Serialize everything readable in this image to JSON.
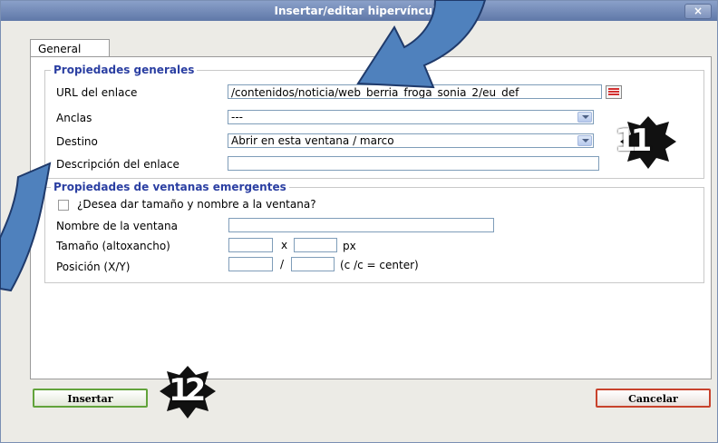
{
  "window": {
    "title": "Insertar/editar hipervínculo",
    "close_label": "×"
  },
  "tabs": [
    {
      "label": "General"
    }
  ],
  "general": {
    "legend": "Propiedades generales",
    "url": {
      "label": "URL del enlace",
      "value": "/contenidos/noticia/web_berria_froga_sonia_2/eu_def"
    },
    "anclas": {
      "label": "Anclas",
      "value": "---"
    },
    "destino": {
      "label": "Destino",
      "value": "Abrir en esta ventana / marco"
    },
    "descripcion": {
      "label": "Descripción del enlace",
      "value": ""
    }
  },
  "popup": {
    "legend": "Propiedades de ventanas emergentes",
    "checkbox_label": "¿Desea dar tamaño y nombre a la ventana?",
    "nombre_label": "Nombre de la ventana",
    "tamano_label": "Tamaño (altoxancho)",
    "tamano_sep": "x",
    "tamano_unit": "px",
    "posicion_label": "Posición (X/Y)",
    "posicion_sep": "/",
    "posicion_hint": "(c /c = center)"
  },
  "buttons": {
    "insert": "Insertar",
    "cancel": "Cancelar"
  },
  "annotations": {
    "step_a": "11",
    "step_b": "12"
  },
  "colors": {
    "arrow_fill": "#4f81bd",
    "legend": "#2b3fa2"
  }
}
